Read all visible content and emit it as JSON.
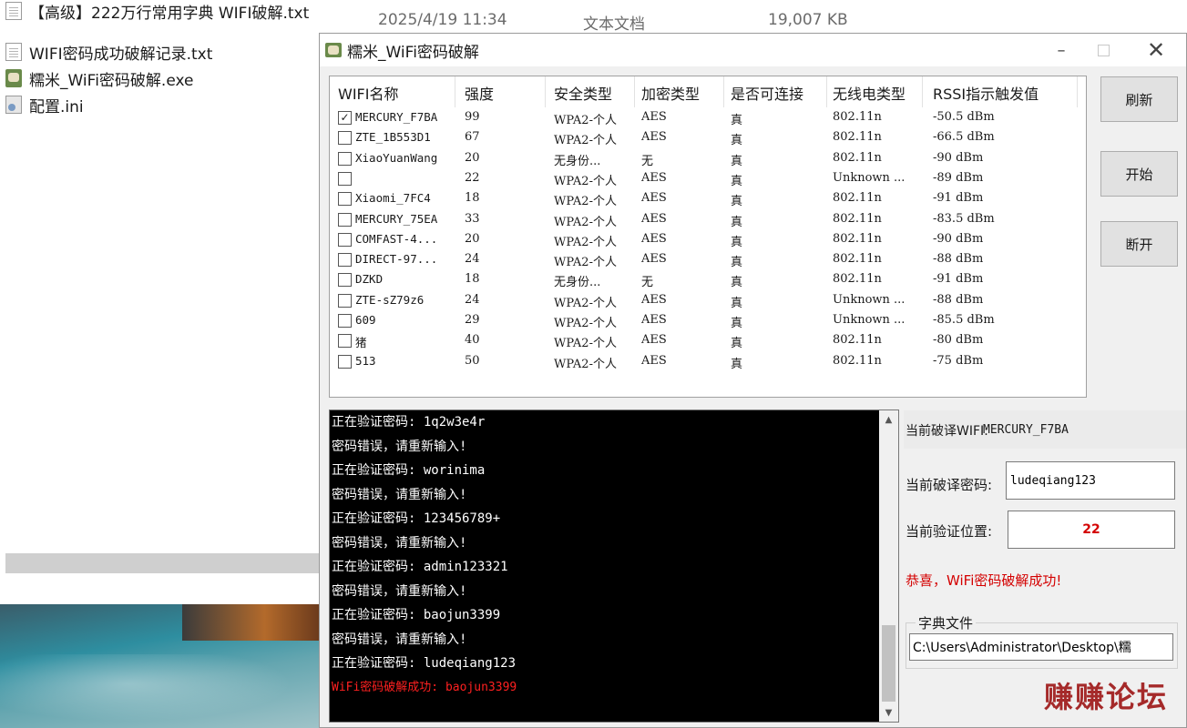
{
  "explorer": {
    "files": [
      {
        "name": "【高级】222万行常用字典 WIFI破解.txt",
        "icon": "text-file-icon"
      },
      {
        "name": "WIFI密码成功破解记录.txt",
        "icon": "text-file-icon"
      },
      {
        "name": "糯米_WiFi密码破解.exe",
        "icon": "exe-icon"
      },
      {
        "name": "配置.ini",
        "icon": "ini-file-icon"
      }
    ],
    "top_file_meta": {
      "date": "2025/4/19 11:34",
      "type": "文本文档",
      "size": "19,007 KB"
    }
  },
  "window": {
    "title": "糯米_WiFi密码破解",
    "controls": {
      "minimize": "–",
      "close": "✕"
    }
  },
  "wifi_table": {
    "columns": [
      "WIFI名称",
      "强度",
      "安全类型",
      "加密类型",
      "是否可连接",
      "无线电类型",
      "RSSI指示触发值"
    ],
    "rows": [
      {
        "checked": true,
        "ssid": "MERCURY_F7BA",
        "strength": "99",
        "security": "WPA2-个人",
        "encryption": "AES",
        "connectable": "真",
        "radio": "802.11n",
        "rssi": "-50.5 dBm"
      },
      {
        "checked": false,
        "ssid": "ZTE_1B553D1",
        "strength": "67",
        "security": "WPA2-个人",
        "encryption": "AES",
        "connectable": "真",
        "radio": "802.11n",
        "rssi": "-66.5 dBm"
      },
      {
        "checked": false,
        "ssid": "XiaoYuanWang",
        "strength": "20",
        "security": "无身份...",
        "encryption": "无",
        "connectable": "真",
        "radio": "802.11n",
        "rssi": "-90 dBm"
      },
      {
        "checked": false,
        "ssid": "",
        "strength": "22",
        "security": "WPA2-个人",
        "encryption": "AES",
        "connectable": "真",
        "radio": "Unknown ...",
        "rssi": "-89 dBm"
      },
      {
        "checked": false,
        "ssid": "Xiaomi_7FC4",
        "strength": "18",
        "security": "WPA2-个人",
        "encryption": "AES",
        "connectable": "真",
        "radio": "802.11n",
        "rssi": "-91 dBm"
      },
      {
        "checked": false,
        "ssid": "MERCURY_75EA",
        "strength": "33",
        "security": "WPA2-个人",
        "encryption": "AES",
        "connectable": "真",
        "radio": "802.11n",
        "rssi": "-83.5 dBm"
      },
      {
        "checked": false,
        "ssid": "COMFAST-4...",
        "strength": "20",
        "security": "WPA2-个人",
        "encryption": "AES",
        "connectable": "真",
        "radio": "802.11n",
        "rssi": "-90 dBm"
      },
      {
        "checked": false,
        "ssid": "DIRECT-97...",
        "strength": "24",
        "security": "WPA2-个人",
        "encryption": "AES",
        "connectable": "真",
        "radio": "802.11n",
        "rssi": "-88 dBm"
      },
      {
        "checked": false,
        "ssid": "DZKD",
        "strength": "18",
        "security": "无身份...",
        "encryption": "无",
        "connectable": "真",
        "radio": "802.11n",
        "rssi": "-91 dBm"
      },
      {
        "checked": false,
        "ssid": "ZTE-sZ79z6",
        "strength": "24",
        "security": "WPA2-个人",
        "encryption": "AES",
        "connectable": "真",
        "radio": "Unknown ...",
        "rssi": "-88 dBm"
      },
      {
        "checked": false,
        "ssid": "609",
        "strength": "29",
        "security": "WPA2-个人",
        "encryption": "AES",
        "connectable": "真",
        "radio": "Unknown ...",
        "rssi": "-85.5 dBm"
      },
      {
        "checked": false,
        "ssid": "猪",
        "strength": "40",
        "security": "WPA2-个人",
        "encryption": "AES",
        "connectable": "真",
        "radio": "802.11n",
        "rssi": "-80 dBm"
      },
      {
        "checked": false,
        "ssid": "513",
        "strength": "50",
        "security": "WPA2-个人",
        "encryption": "AES",
        "connectable": "真",
        "radio": "802.11n",
        "rssi": "-75 dBm"
      }
    ]
  },
  "buttons": {
    "refresh": "刷新",
    "start": "开始",
    "disconnect": "断开"
  },
  "console": {
    "lines": [
      {
        "text": "正在验证密码: 1q2w3e4r",
        "kind": "normal"
      },
      {
        "text": "密码错误，请重新输入!",
        "kind": "normal"
      },
      {
        "text": "正在验证密码: worinima",
        "kind": "normal"
      },
      {
        "text": "密码错误，请重新输入!",
        "kind": "normal"
      },
      {
        "text": "正在验证密码: 123456789+",
        "kind": "normal"
      },
      {
        "text": "密码错误，请重新输入!",
        "kind": "normal"
      },
      {
        "text": "正在验证密码: admin123321",
        "kind": "normal"
      },
      {
        "text": "密码错误，请重新输入!",
        "kind": "normal"
      },
      {
        "text": "正在验证密码: baojun3399",
        "kind": "normal"
      },
      {
        "text": "密码错误，请重新输入!",
        "kind": "normal"
      },
      {
        "text": "正在验证密码: ludeqiang123",
        "kind": "normal"
      },
      {
        "text": "WiFi密码破解成功: baojun3399",
        "kind": "success"
      }
    ]
  },
  "status": {
    "current_wifi_label": "当前破译WIFI:",
    "current_wifi_value": "MERCURY_F7BA",
    "current_password_label": "当前破译密码:",
    "current_password_value": "ludeqiang123",
    "position_label": "当前验证位置:",
    "position_value": "22",
    "success_message": "恭喜，WiFi密码破解成功!",
    "dict_legend": "字典文件",
    "dict_path": "C:\\Users\\Administrator\\Desktop\\糯"
  },
  "watermark": "赚赚论坛",
  "colors": {
    "success_red": "#d40000",
    "console_bg": "#000000",
    "watermark": "#a52a2a"
  }
}
